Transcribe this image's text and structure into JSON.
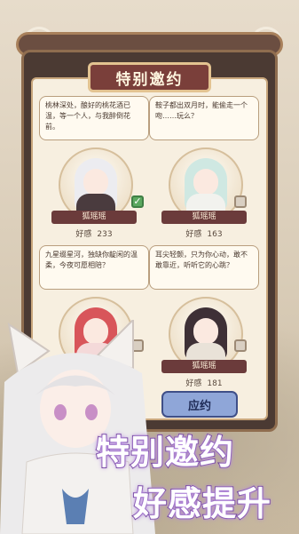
{
  "banner": {
    "title": "特别邀约"
  },
  "cards": [
    {
      "text": "桃林深处，酿好的桃花酒已温，等一个人，与我醉倒花前。",
      "name": "狐瑶瑶",
      "favor_label": "好感",
      "favor_value": "233",
      "checked": true,
      "hair": "#ececf0",
      "outfit": "#4a3b3e"
    },
    {
      "text": "鞍子都出双月时，能偷走一个吻……玩么？",
      "name": "狐瑶瑶",
      "favor_label": "好感",
      "favor_value": "163",
      "checked": false,
      "hair": "#cfe8e2",
      "outfit": "#f2f2ee"
    },
    {
      "text": "九星缀星河，独缺你靛闲的温柔，今夜可愿相陪？",
      "name": "",
      "favor_label": "",
      "favor_value": "",
      "checked": false,
      "hair": "#d8555a",
      "outfit": "#f4d9d9"
    },
    {
      "text": "耳尖轻颤，只为你心动，敢不敢靠近，听听它的心跳？",
      "name": "狐瑶瑶",
      "favor_label": "好感",
      "favor_value": "181",
      "checked": false,
      "hair": "#3e3036",
      "outfit": "#e9e2d8"
    }
  ],
  "buttons": {
    "accept": "应约"
  },
  "slogan": {
    "line1": "特别邀约",
    "line2": "好感提升"
  },
  "colors": {
    "accent_purple": "#5b2d86",
    "frame": "#4b3a33",
    "banner": "#7a3f3a",
    "accept": "#8fa6d8"
  }
}
